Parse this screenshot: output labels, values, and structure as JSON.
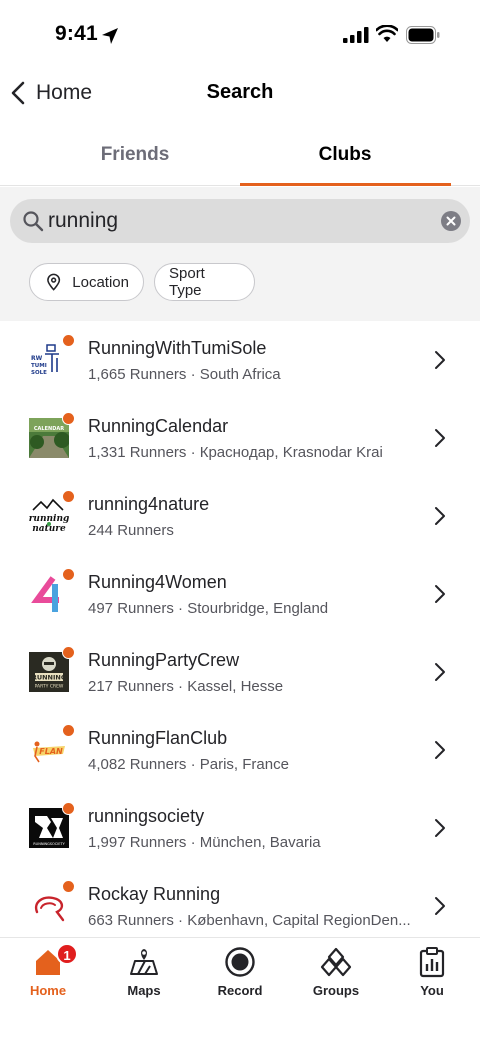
{
  "status_bar": {
    "time": "9:41"
  },
  "nav": {
    "back_label": "Home",
    "title": "Search"
  },
  "tabs": [
    {
      "label": "Friends",
      "active": false
    },
    {
      "label": "Clubs",
      "active": true
    }
  ],
  "search": {
    "value": "running"
  },
  "filters": {
    "location_label": "Location",
    "sport_type_label": "Sport Type"
  },
  "clubs": [
    {
      "name": "RunningWithTumiSole",
      "meta": "1,665 Runners · South Africa"
    },
    {
      "name": "RunningCalendar",
      "meta": "1,331 Runners · Краснодар, Krasnodar Krai"
    },
    {
      "name": "running4nature",
      "meta": "244 Runners"
    },
    {
      "name": "Running4Women",
      "meta": "497 Runners · Stourbridge, England"
    },
    {
      "name": "RunningPartyCrew",
      "meta": "217 Runners · Kassel, Hesse"
    },
    {
      "name": "RunningFlanClub",
      "meta": "4,082 Runners · Paris, France"
    },
    {
      "name": "runningsociety",
      "meta": "1,997 Runners · München, Bavaria"
    },
    {
      "name": "Rockay Running",
      "meta": "663 Runners · København, Capital RegionDen..."
    }
  ],
  "tabbar": {
    "home_label": "Home",
    "home_badge": "1",
    "maps_label": "Maps",
    "record_label": "Record",
    "groups_label": "Groups",
    "you_label": "You"
  },
  "colors": {
    "accent": "#e4611d",
    "badge": "#e01e1e",
    "search_bg": "#f3f3f3"
  }
}
